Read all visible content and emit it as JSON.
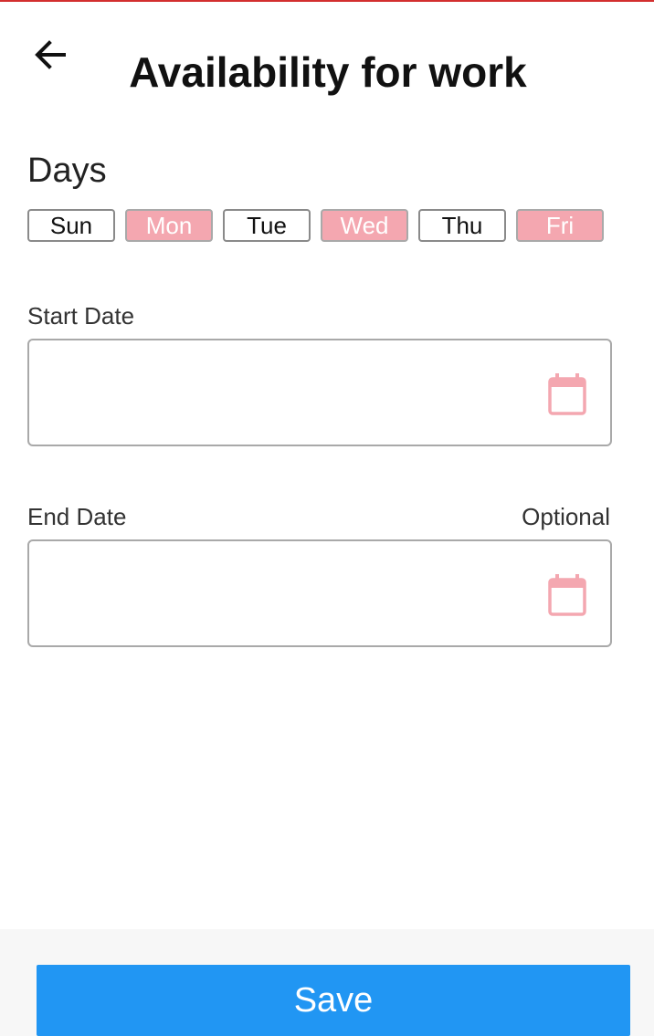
{
  "header": {
    "back_icon": "arrow-left-icon",
    "title": "Availability for work"
  },
  "days": {
    "label": "Days",
    "items": [
      {
        "label": "Sun",
        "selected": false
      },
      {
        "label": "Mon",
        "selected": true
      },
      {
        "label": "Tue",
        "selected": false
      },
      {
        "label": "Wed",
        "selected": true
      },
      {
        "label": "Thu",
        "selected": false
      },
      {
        "label": "Fri",
        "selected": true
      }
    ]
  },
  "start_date": {
    "label": "Start Date",
    "value": "",
    "icon": "calendar-icon"
  },
  "end_date": {
    "label": "End Date",
    "optional_label": "Optional",
    "value": "",
    "icon": "calendar-icon"
  },
  "footer": {
    "save_label": "Save"
  },
  "colors": {
    "accent": "#2196f3",
    "selected_day": "#f4a7b0",
    "calendar_icon": "#f4a7b0",
    "top_line": "#d32f2f"
  }
}
